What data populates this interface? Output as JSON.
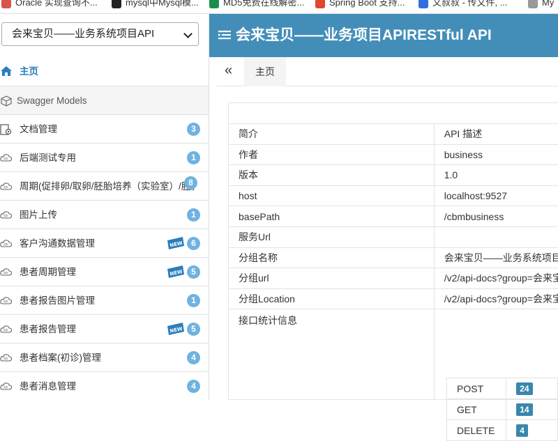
{
  "bookmarks": [
    {
      "label": "Oracle 实现查询不...",
      "color": "#d9534f"
    },
    {
      "label": "mysql中Mysql模...",
      "color": "#222222"
    },
    {
      "label": "MD5免费在线解密...",
      "color": "#1a8f4c"
    },
    {
      "label": "Spring Boot 支持...",
      "color": "#e2452f"
    },
    {
      "label": "文叔叔 - 传文件, ...",
      "color": "#2f6fe0"
    },
    {
      "label": "My",
      "color": "#999999"
    }
  ],
  "group_select": {
    "value": "会来宝贝——业务系统项目API"
  },
  "header": {
    "title": "会来宝贝——业务项目APIRESTful API",
    "bg": "#438eb9"
  },
  "sidebar": {
    "home": "主页",
    "models": "Swagger Models",
    "items": [
      {
        "label": "文档管理",
        "count": "3",
        "new": false
      },
      {
        "label": "后端测试专用",
        "count": "1",
        "new": false
      },
      {
        "label": "周期(促排卵/取卵/胚胎培养（实验室）/胚胎移植",
        "count": "8",
        "new": false
      },
      {
        "label": "图片上传",
        "count": "1",
        "new": false
      },
      {
        "label": "客户沟通数据管理",
        "count": "6",
        "new": true
      },
      {
        "label": "患者周期管理",
        "count": "5",
        "new": true
      },
      {
        "label": "患者报告图片管理",
        "count": "1",
        "new": false
      },
      {
        "label": "患者报告管理",
        "count": "5",
        "new": true
      },
      {
        "label": "患者档案(初诊)管理",
        "count": "4",
        "new": false
      },
      {
        "label": "患者消息管理",
        "count": "4",
        "new": false
      }
    ],
    "new_badge": "NEW"
  },
  "main": {
    "collapse": "«",
    "tab": "主页",
    "rows": [
      {
        "k": "简介",
        "v": "API 描述"
      },
      {
        "k": "作者",
        "v": "business"
      },
      {
        "k": "版本",
        "v": "1.0"
      },
      {
        "k": "host",
        "v": "localhost:9527"
      },
      {
        "k": "basePath",
        "v": "/cbmbusiness"
      },
      {
        "k": "服务Url",
        "v": ""
      },
      {
        "k": "分组名称",
        "v": "会来宝贝——业务系统项目"
      },
      {
        "k": "分组url",
        "v": "/v2/api-docs?group=会来宝"
      },
      {
        "k": "分组Location",
        "v": "/v2/api-docs?group=会来宝"
      }
    ],
    "stats_label": "接口统计信息",
    "stats": [
      {
        "method": "POST",
        "count": "24"
      },
      {
        "method": "GET",
        "count": "14"
      },
      {
        "method": "DELETE",
        "count": "4"
      }
    ]
  }
}
